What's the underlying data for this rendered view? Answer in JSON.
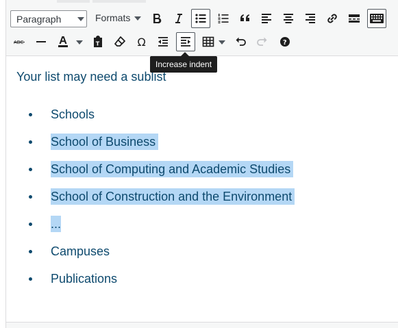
{
  "toolbar": {
    "block_format": {
      "selected": "Paragraph"
    },
    "formats_label": "Formats",
    "row1": [
      {
        "name": "bold-button",
        "icon": "bold-icon",
        "title": "Bold"
      },
      {
        "name": "italic-button",
        "icon": "italic-icon",
        "title": "Italic"
      },
      {
        "name": "bulleted-list-button",
        "icon": "bulleted-list-icon",
        "title": "Bulleted list",
        "active": true
      },
      {
        "name": "numbered-list-button",
        "icon": "numbered-list-icon",
        "title": "Numbered list"
      },
      {
        "name": "blockquote-button",
        "icon": "blockquote-icon",
        "title": "Blockquote"
      },
      {
        "name": "align-left-button",
        "icon": "align-left-icon",
        "title": "Align left"
      },
      {
        "name": "align-center-button",
        "icon": "align-center-icon",
        "title": "Align center"
      },
      {
        "name": "align-right-button",
        "icon": "align-right-icon",
        "title": "Align right"
      },
      {
        "name": "insert-link-button",
        "icon": "link-icon",
        "title": "Insert/edit link"
      },
      {
        "name": "read-more-button",
        "icon": "read-more-icon",
        "title": "Insert Read More tag"
      },
      {
        "name": "toolbar-toggle-button",
        "icon": "keyboard-icon",
        "title": "Toolbar Toggle",
        "active": true
      }
    ],
    "row2": [
      {
        "name": "strikethrough-button",
        "icon": "strikethrough-icon",
        "title": "Strikethrough"
      },
      {
        "name": "horizontal-line-button",
        "icon": "horizontal-line-icon",
        "title": "Horizontal line"
      },
      {
        "name": "text-color-button",
        "icon": "text-color-icon",
        "title": "Text color"
      },
      {
        "name": "paste-text-button",
        "icon": "clipboard-icon",
        "title": "Paste as text"
      },
      {
        "name": "clear-formatting-button",
        "icon": "eraser-icon",
        "title": "Clear formatting"
      },
      {
        "name": "special-character-button",
        "icon": "omega-icon",
        "title": "Special character"
      },
      {
        "name": "decrease-indent-button",
        "icon": "outdent-icon",
        "title": "Decrease indent"
      },
      {
        "name": "increase-indent-button",
        "icon": "indent-icon",
        "title": "Increase indent",
        "active": true
      },
      {
        "name": "table-button",
        "icon": "table-icon",
        "title": "Table"
      },
      {
        "name": "undo-button",
        "icon": "undo-icon",
        "title": "Undo"
      },
      {
        "name": "redo-button",
        "icon": "redo-icon",
        "title": "Redo",
        "disabled": true
      },
      {
        "name": "keyboard-shortcuts-button",
        "icon": "help-icon",
        "title": "Keyboard Shortcuts"
      }
    ],
    "text_color_swatch": "#1e1e1e"
  },
  "tooltip": {
    "text": "Increase indent"
  },
  "content": {
    "intro": "Your list may need a sublist",
    "items": [
      {
        "text": "Schools",
        "selected": false
      },
      {
        "text": "School of Business",
        "selected": true
      },
      {
        "text": "School of Computing and Academic Studies",
        "selected": true
      },
      {
        "text": "School of Construction and the Environment",
        "selected": true
      },
      {
        "text": "...",
        "selected": true
      },
      {
        "text": "Campuses",
        "selected": false
      },
      {
        "text": "Publications",
        "selected": false
      }
    ]
  },
  "colors": {
    "text": "#0e4a6e",
    "selection": "#b4d7f5",
    "toolbar_bg": "#f6f7f7",
    "icon": "#1e1e1e"
  }
}
